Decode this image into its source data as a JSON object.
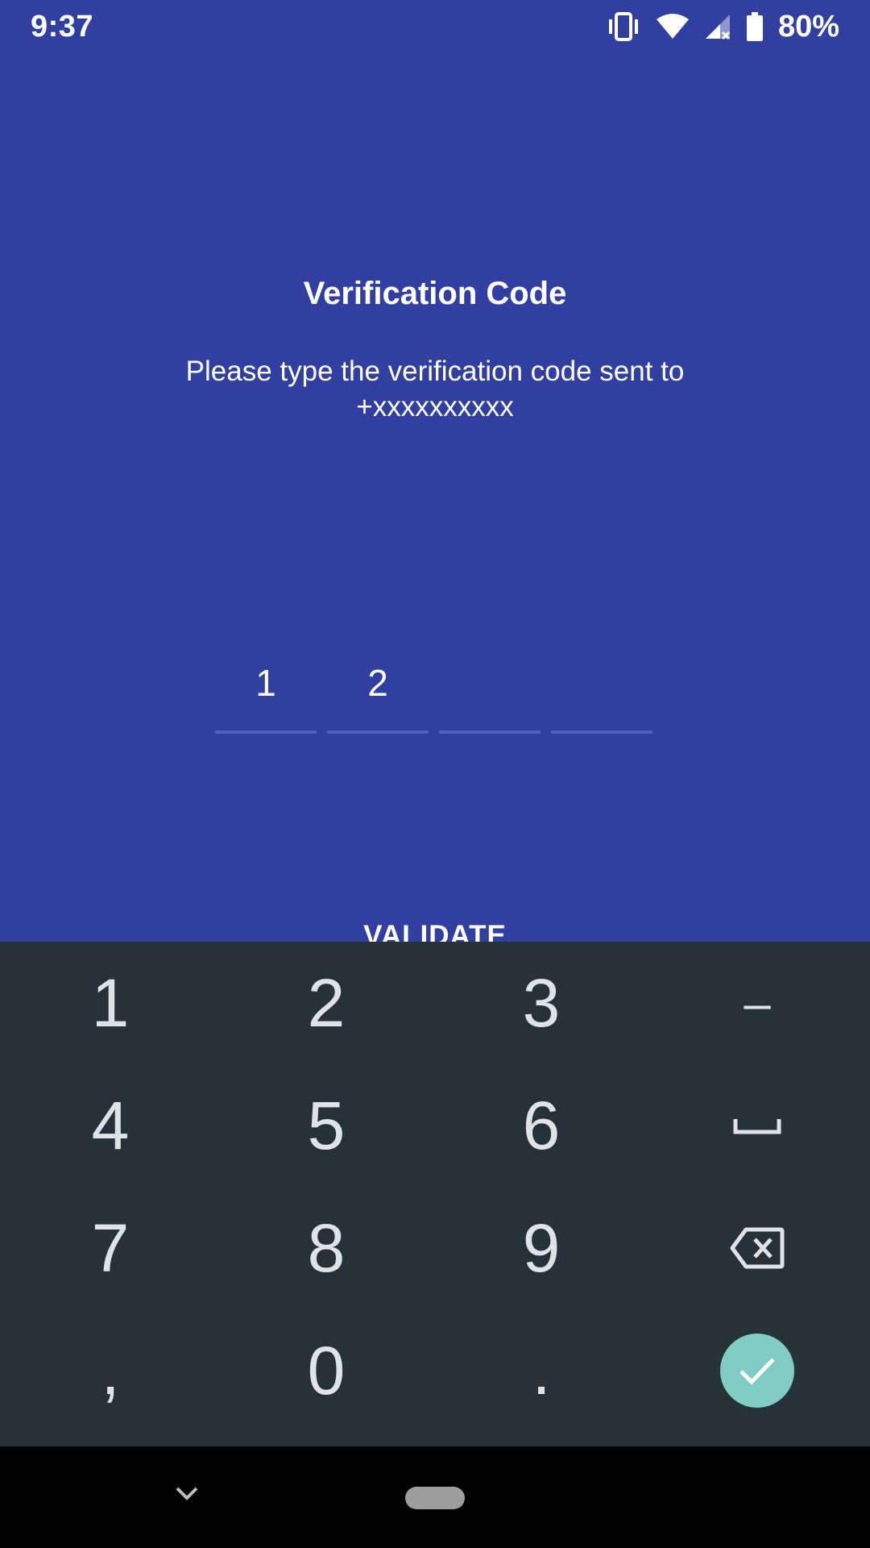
{
  "status_bar": {
    "time": "9:37",
    "battery_percent": "80%",
    "icons": [
      "vibrate-icon",
      "wifi-icon",
      "cell-signal-icon",
      "battery-icon"
    ]
  },
  "screen": {
    "title": "Verification Code",
    "subtitle_line1": "Please type the verification code sent to",
    "subtitle_line2": "+xxxxxxxxxx",
    "code_digits": [
      "1",
      "2",
      "",
      ""
    ],
    "validate_label": "VALIDATE"
  },
  "keyboard": {
    "keys": [
      {
        "label": "1",
        "name": "key-1"
      },
      {
        "label": "2",
        "name": "key-2"
      },
      {
        "label": "3",
        "name": "key-3"
      },
      {
        "label": "–",
        "name": "key-dash"
      },
      {
        "label": "4",
        "name": "key-4"
      },
      {
        "label": "5",
        "name": "key-5"
      },
      {
        "label": "6",
        "name": "key-6"
      },
      {
        "label": "",
        "name": "key-space",
        "icon": "space-icon"
      },
      {
        "label": "7",
        "name": "key-7"
      },
      {
        "label": "8",
        "name": "key-8"
      },
      {
        "label": "9",
        "name": "key-9"
      },
      {
        "label": "",
        "name": "key-backspace",
        "icon": "backspace-icon"
      },
      {
        "label": ",",
        "name": "key-comma"
      },
      {
        "label": "0",
        "name": "key-0"
      },
      {
        "label": ".",
        "name": "key-period"
      },
      {
        "label": "",
        "name": "key-confirm",
        "icon": "checkmark-icon"
      }
    ]
  },
  "colors": {
    "primary": "#313fa0",
    "keyboard_bg": "#263237",
    "confirm_accent": "#80cbc4",
    "underline": "#4f5fc2"
  }
}
